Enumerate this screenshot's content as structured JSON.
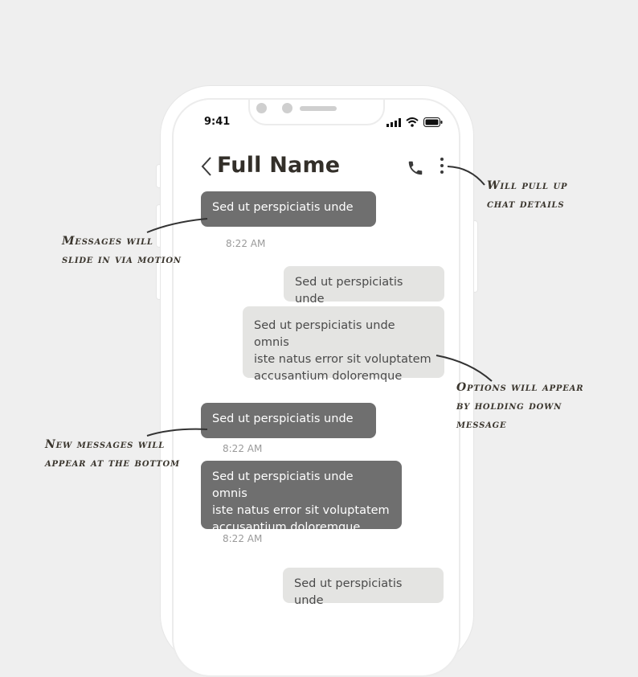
{
  "status_bar": {
    "time": "9:41",
    "icons": [
      "signal-icon",
      "wifi-icon",
      "battery-icon"
    ]
  },
  "header": {
    "back_icon": "chevron-left-icon",
    "title": "Full Name",
    "call_icon": "phone-icon",
    "menu_icon": "more-vertical-icon"
  },
  "messages": [
    {
      "direction": "received",
      "text": "Sed ut perspiciatis unde",
      "time": "8:22 AM"
    },
    {
      "direction": "sent",
      "text": "Sed ut perspiciatis unde"
    },
    {
      "direction": "sent",
      "text": "Sed ut perspiciatis unde omnis\n iste natus error sit voluptatem\naccusantium doloremque"
    },
    {
      "direction": "received",
      "text": "Sed ut perspiciatis unde",
      "time": "8:22 AM"
    },
    {
      "direction": "received",
      "text": "Sed ut perspiciatis unde omnis\n iste natus error sit voluptatem\naccusantium doloremque",
      "time": "8:22 AM"
    },
    {
      "direction": "sent",
      "text": "Sed ut perspiciatis unde"
    }
  ],
  "annotations": {
    "chat_details": "Will pull up\nchat details",
    "slide_motion": "Messages will\nslide in via motion",
    "options": "Options will appear\nby holding down\nmessage",
    "bottom": "New messages will\nappear at the bottom"
  },
  "colors": {
    "background": "#efefef",
    "received_bubble": "#6f6f6f",
    "sent_bubble": "#e4e4e2",
    "title": "#332f29"
  }
}
